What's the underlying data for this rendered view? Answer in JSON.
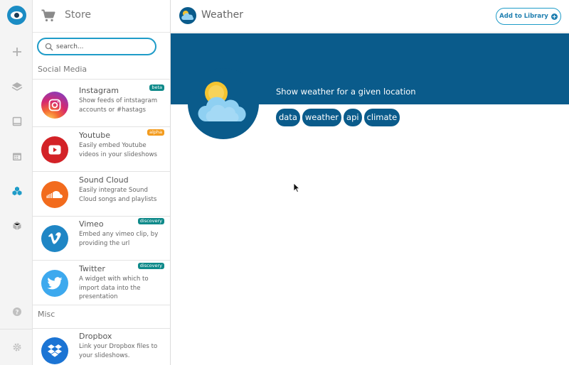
{
  "app": {
    "accent": "#1f9cc8",
    "banner_color": "#0a5b8b"
  },
  "rail": {
    "items": [
      {
        "icon": "plus-icon"
      },
      {
        "icon": "layers-icon"
      },
      {
        "icon": "slide-icon"
      },
      {
        "icon": "calendar-icon"
      },
      {
        "icon": "widgets-icon",
        "active": true
      },
      {
        "icon": "cube-icon"
      },
      {
        "icon": "help-icon"
      },
      {
        "icon": "gear-icon"
      }
    ]
  },
  "store": {
    "title": "Store",
    "search": {
      "placeholder": "search...",
      "value": ""
    },
    "sections": [
      {
        "label": "Social Media",
        "items": [
          {
            "title": "Instagram",
            "badge": "beta",
            "desc": "Show feeds of intstagram accounts or #hastags"
          },
          {
            "title": "Youtube",
            "badge": "alpha",
            "desc": "Easily embed Youtube videos in your slideshows"
          },
          {
            "title": "Sound Cloud",
            "badge": "",
            "desc": "Easily integrate Sound Cloud songs and playlists"
          },
          {
            "title": "Vimeo",
            "badge": "discovery",
            "desc": "Embed any vimeo clip, by providing the url"
          },
          {
            "title": "Twitter",
            "badge": "discovery",
            "desc": "A widget with which to import data into the presentation"
          }
        ]
      },
      {
        "label": "Misc",
        "items": [
          {
            "title": "Dropbox",
            "badge": "",
            "desc": "Link your Dropbox files to your slideshows."
          }
        ]
      }
    ]
  },
  "main": {
    "title": "Weather",
    "add_button": "Add to Library",
    "description": "Show weather for a given location",
    "tags": [
      "data",
      "weather",
      "api",
      "climate"
    ]
  }
}
